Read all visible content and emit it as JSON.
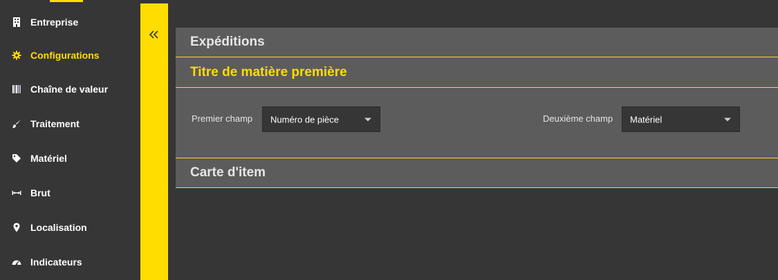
{
  "sidebar": {
    "items": [
      {
        "label": "Entreprise",
        "icon": "building-icon",
        "active": false
      },
      {
        "label": "Configurations",
        "icon": "gear-icon",
        "active": true
      },
      {
        "label": "Chaîne de valeur",
        "icon": "barcode-icon",
        "active": false
      },
      {
        "label": "Traitement",
        "icon": "brush-icon",
        "active": false
      },
      {
        "label": "Matériel",
        "icon": "tag-icon",
        "active": false
      },
      {
        "label": "Brut",
        "icon": "measure-icon",
        "active": false
      },
      {
        "label": "Localisation",
        "icon": "map-marker-icon",
        "active": false
      },
      {
        "label": "Indicateurs",
        "icon": "dashboard-icon",
        "active": false
      }
    ]
  },
  "collapse": {
    "icon": "double-chevron-left-icon"
  },
  "panel": {
    "sections": {
      "expeditions": {
        "title": "Expéditions"
      },
      "raw_material_title": {
        "title": "Titre de matière première"
      },
      "item_card": {
        "title": "Carte d'item"
      }
    },
    "fields": {
      "first": {
        "label": "Premier champ",
        "value": "Numéro de pièce"
      },
      "second": {
        "label": "Deuxième champ",
        "value": "Matériel"
      }
    }
  },
  "colors": {
    "accent": "#FFDD00",
    "background": "#363636",
    "panel": "#5C5C5C",
    "text": "#FFFFFF"
  }
}
